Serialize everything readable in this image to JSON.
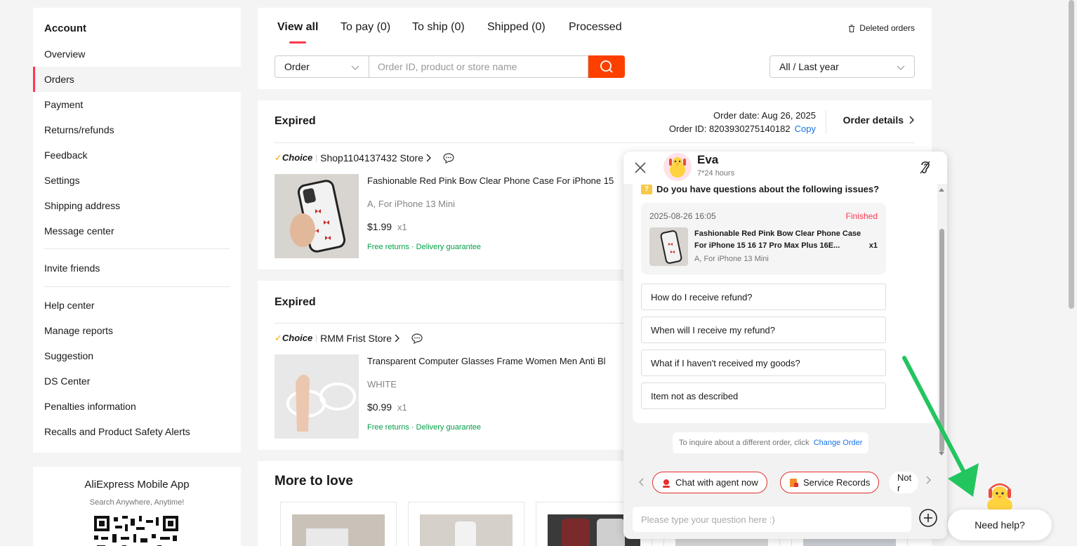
{
  "sidebar": {
    "title": "Account",
    "items": [
      "Overview",
      "Orders",
      "Payment",
      "Returns/refunds",
      "Feedback",
      "Settings",
      "Shipping address",
      "Message center"
    ],
    "group2": [
      "Invite friends"
    ],
    "group3": [
      "Help center",
      "Manage reports",
      "Suggestion",
      "DS Center",
      "Penalties information",
      "Recalls and Product Safety Alerts"
    ]
  },
  "app_promo": {
    "title": "AliExpress Mobile App",
    "subtitle": "Search Anywhere, Anytime!"
  },
  "tabs": [
    "View all",
    "To pay (0)",
    "To ship (0)",
    "Shipped (0)",
    "Processed"
  ],
  "deleted_orders": "Deleted orders",
  "filter": {
    "type_value": "Order",
    "search_placeholder": "Order ID, product or store name",
    "period_value": "All / Last year"
  },
  "orders": [
    {
      "status": "Expired",
      "order_date": "Order date: Aug 26, 2025",
      "order_id": "Order ID: 8203930275140182",
      "copy": "Copy",
      "details": "Order details",
      "choice": "Choice",
      "store": "Shop1104137432 Store",
      "title": "Fashionable Red Pink Bow Clear Phone Case For iPhone 15",
      "sku": "A, For iPhone 13 Mini",
      "price": "$1.99",
      "qty": "x1",
      "badges": "Free returns · Delivery guarantee"
    },
    {
      "status": "Expired",
      "choice": "Choice",
      "store": "RMM Frist Store",
      "title": "Transparent Computer Glasses Frame Women Men Anti Bl",
      "sku": "WHITE",
      "price": "$0.99",
      "qty": "x1",
      "badges": "Free returns · Delivery guarantee"
    }
  ],
  "more_to_love": "More to love",
  "chat": {
    "agent_name": "Eva",
    "hours": "7*24 hours",
    "question_title": "Do you have questions about the following issues?",
    "order": {
      "date": "2025-08-26 16:05",
      "status": "Finished",
      "title": "Fashionable Red Pink Bow Clear Phone Case For iPhone 15 16 17 Pro Max Plus 16E...",
      "qty": "x1",
      "sku": "A, For iPhone 13 Mini"
    },
    "faqs": [
      "How do I receive refund?",
      "When will I receive my refund?",
      "What if I haven't received my goods?",
      "Item not as described"
    ],
    "inquire_text": "To inquire about a different order, click",
    "change_order": "Change Order",
    "quick": [
      "Chat with agent now",
      "Service Records",
      "Not r"
    ],
    "input_placeholder": "Please type your question here :)"
  },
  "need_help": "Need help?",
  "colors": {
    "accent": "#fd384f",
    "search_button": "#fd4000",
    "link": "#1a73e8",
    "badge_green": "#00a046",
    "annotation_arrow": "#22c55e"
  }
}
